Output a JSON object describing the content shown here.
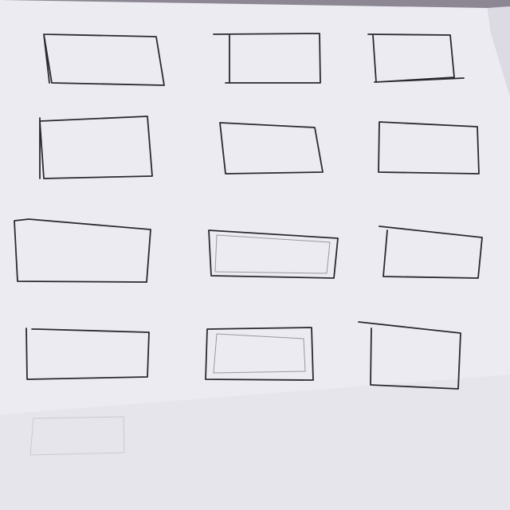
{
  "scene": {
    "subject": "hand-drawn-rectangles-on-paper",
    "colors": {
      "background": "#8c8792",
      "paper": "#ecebf2",
      "paper_shadow": "#dcdae3",
      "ink": "#2a2a2e",
      "pencil": "#9a98a0"
    },
    "rows": 4,
    "columns": 3,
    "rectangle_count": 12
  }
}
